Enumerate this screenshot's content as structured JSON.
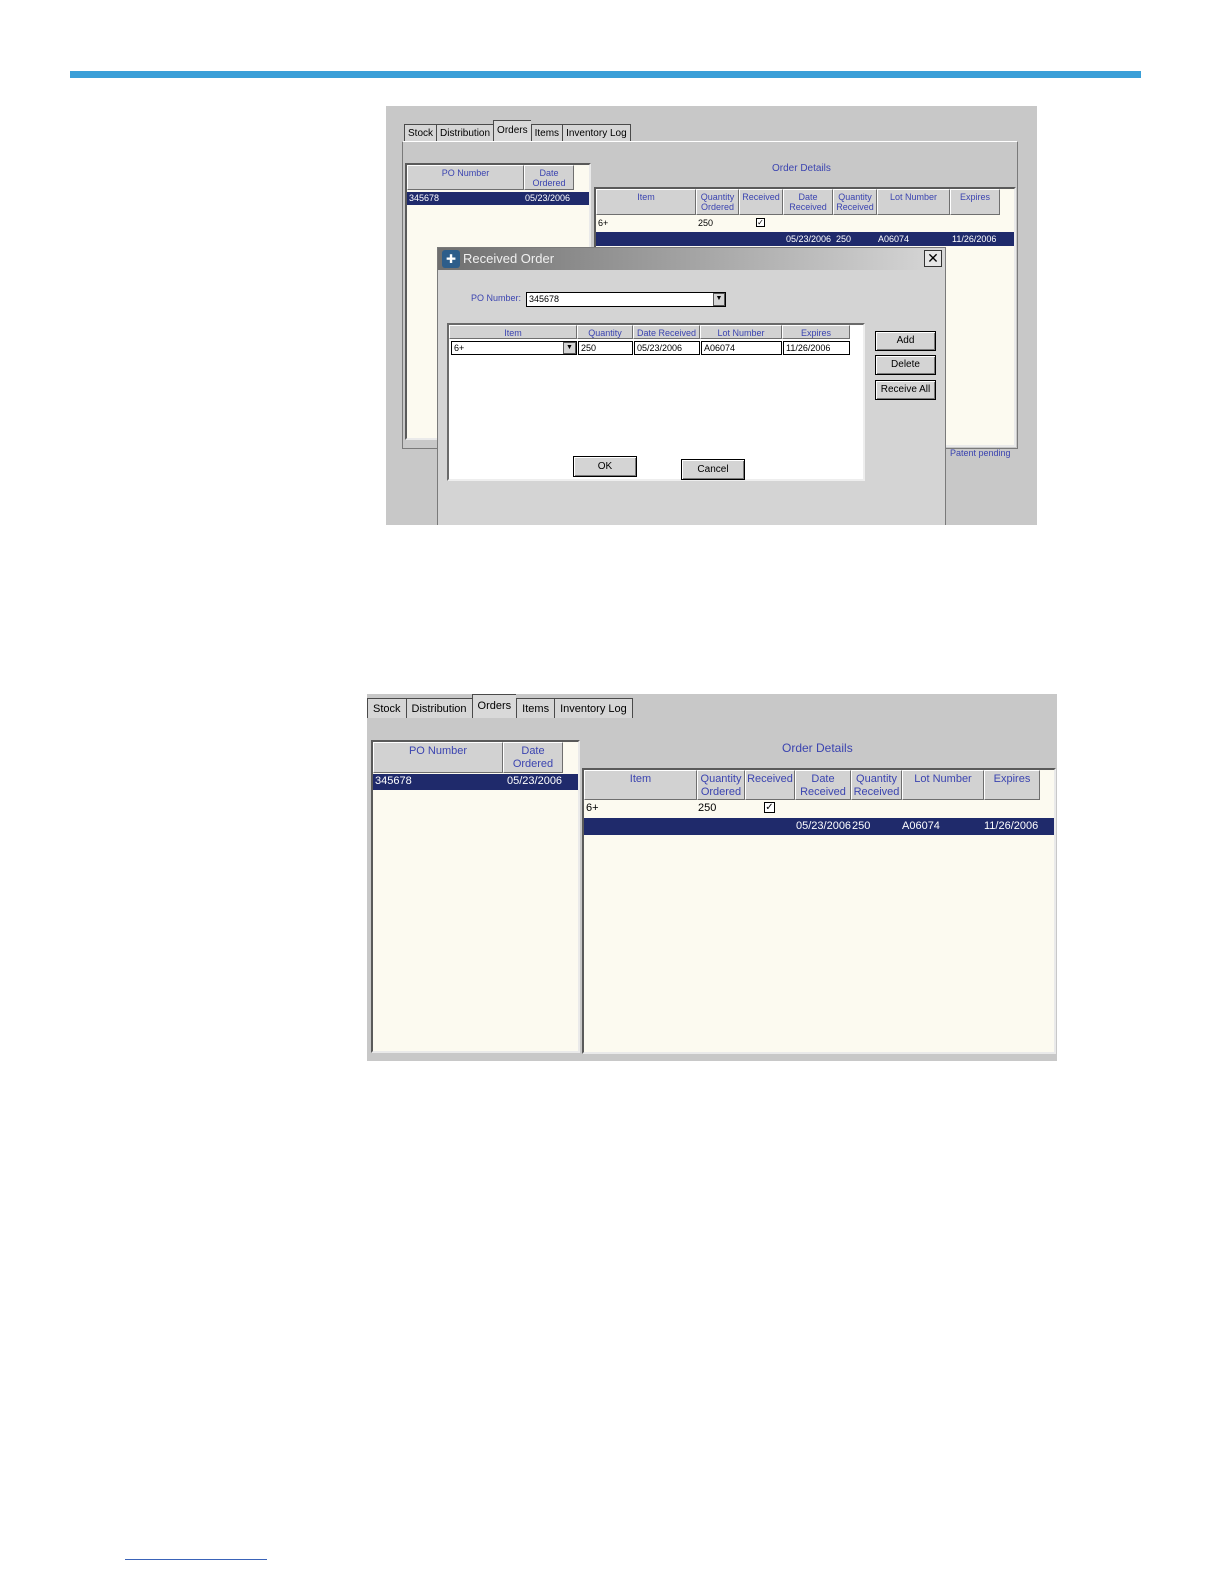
{
  "tabs": [
    "Stock",
    "Distribution",
    "Orders",
    "Items",
    "Inventory Log"
  ],
  "active_tab": "Orders",
  "po_list": {
    "headers": [
      "PO Number",
      "Date Ordered"
    ],
    "rows": [
      {
        "po": "345678",
        "date": "05/23/2006"
      }
    ]
  },
  "order_details": {
    "title": "Order Details",
    "headers": [
      "Item",
      "Quantity Ordered",
      "Received",
      "Date Received",
      "Quantity Received",
      "Lot Number",
      "Expires"
    ],
    "row1": {
      "item": "6+",
      "qty_ordered": "250",
      "received_checked": true
    },
    "row2": {
      "date_received": "05/23/2006",
      "qty_received": "250",
      "lot": "A06074",
      "expires": "11/26/2006"
    }
  },
  "dialog": {
    "title": "Received Order",
    "po_label": "PO Number:",
    "po_value": "345678",
    "headers": [
      "Item",
      "Quantity",
      "Date Received",
      "Lot Number",
      "Expires"
    ],
    "row": {
      "item": "6+",
      "qty": "250",
      "date_received": "05/23/2006",
      "lot": "A06074",
      "expires": "11/26/2006"
    },
    "buttons": {
      "add": "Add",
      "delete": "Delete",
      "receive_all": "Receive All",
      "ok": "OK",
      "cancel": "Cancel"
    }
  },
  "patent": "Patent pending",
  "check_glyph": "✓",
  "colors": {
    "accent_bar": "#3a9fd8",
    "selection": "#1f2a6b",
    "header_text": "#3b44b0"
  }
}
